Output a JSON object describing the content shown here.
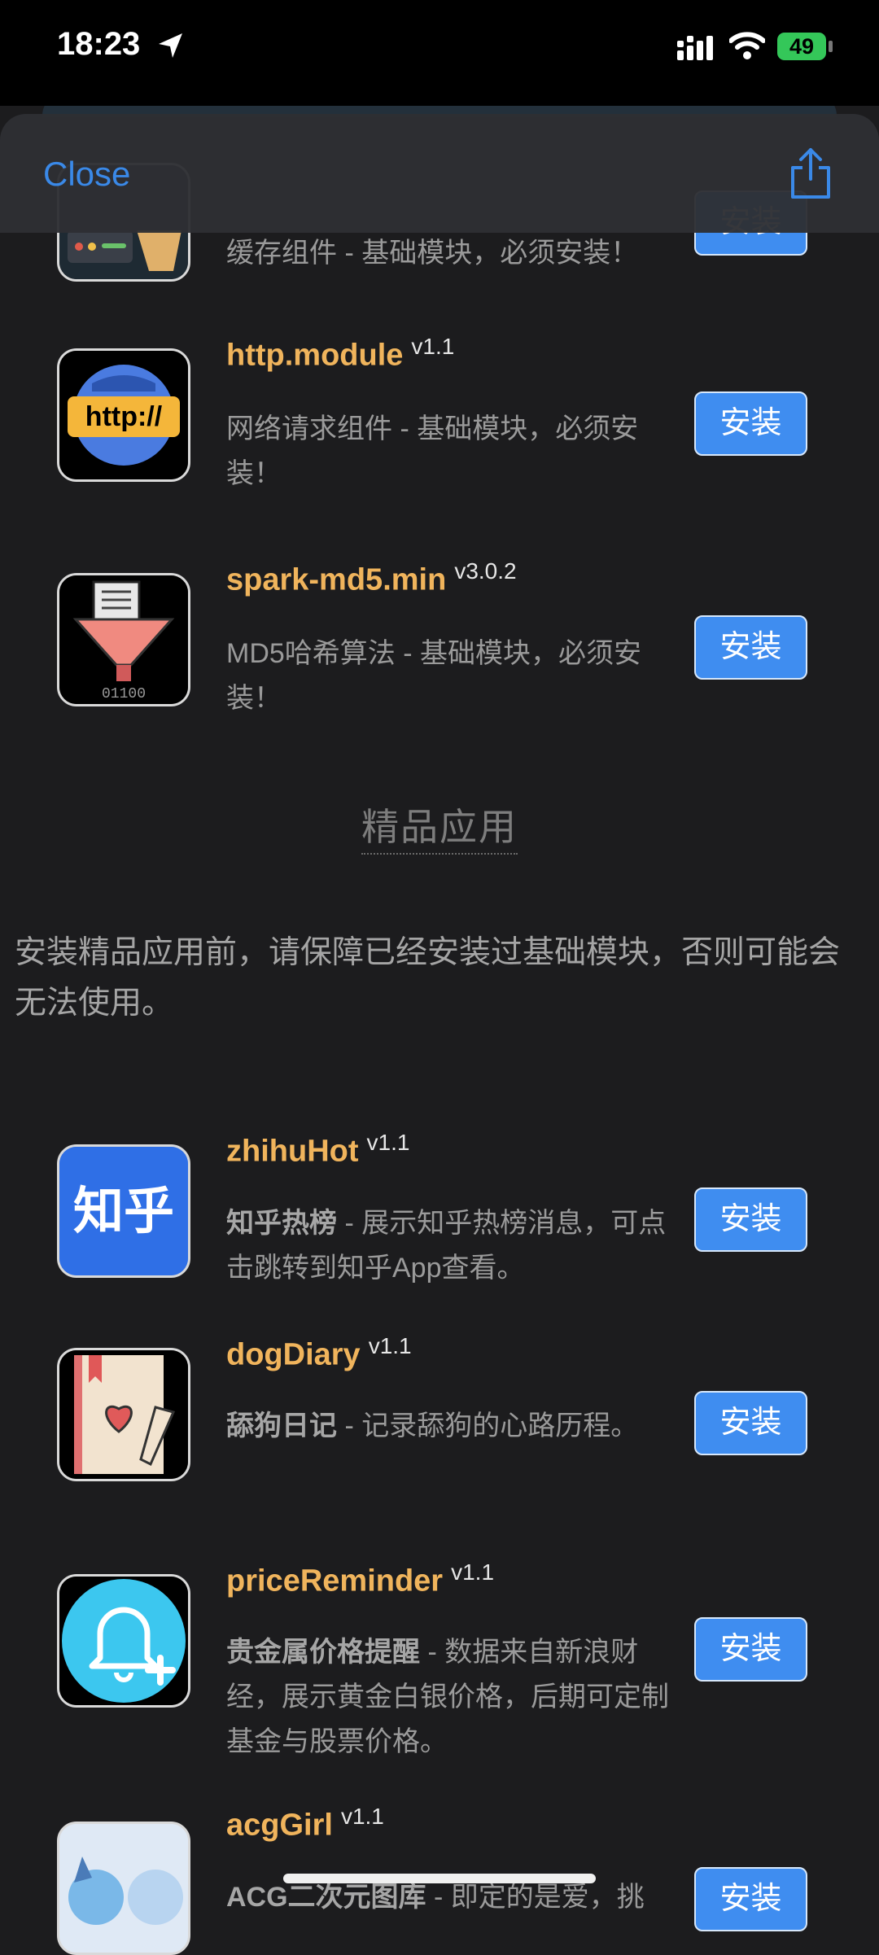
{
  "status_bar": {
    "time": "18:23",
    "battery": "49"
  },
  "navbar": {
    "close_label": "Close"
  },
  "basic_modules": [
    {
      "desc": "缓存组件 - 基础模块，必须安装！",
      "install": "安装"
    },
    {
      "name": "http.module",
      "version": "v1.1",
      "desc": "网络请求组件 - 基础模块，必须安装！",
      "install": "安装",
      "icon_text": "http://"
    },
    {
      "name": "spark-md5.min",
      "version": "v3.0.2",
      "desc": "MD5哈希算法 - 基础模块，必须安装！",
      "install": "安装",
      "icon_text": "01100"
    }
  ],
  "section": {
    "title": "精品应用",
    "notice": "安装精品应用前，请保障已经安装过基础模块，否则可能会无法使用。"
  },
  "premium_apps": [
    {
      "name": "zhihuHot",
      "version": "v1.1",
      "desc_bold": "知乎热榜",
      "desc": " - 展示知乎热榜消息，可点击跳转到知乎App查看。",
      "install": "安装",
      "icon_text": "知乎"
    },
    {
      "name": "dogDiary",
      "version": "v1.1",
      "desc_bold": "舔狗日记",
      "desc": " - 记录舔狗的心路历程。",
      "install": "安装"
    },
    {
      "name": "priceReminder",
      "version": "v1.1",
      "desc_bold": "贵金属价格提醒",
      "desc": " - 数据来自新浪财经，展示黄金白银价格，后期可定制基金与股票价格。",
      "install": "安装"
    },
    {
      "name": "acgGirl",
      "version": "v1.1",
      "desc_bold": "ACG二次元图库",
      "desc": " - 即定的是爱，挑",
      "install": "安装"
    }
  ],
  "colors": {
    "accent": "#3f8df0",
    "name": "#f0b45c",
    "background": "#1c1c1e"
  }
}
